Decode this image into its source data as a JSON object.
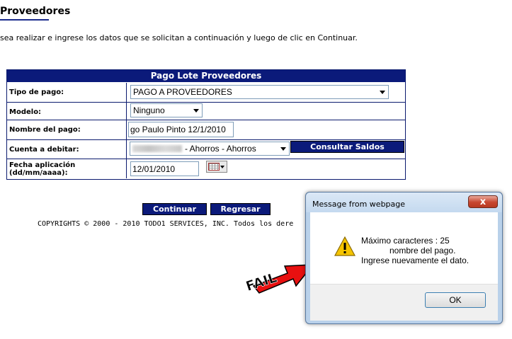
{
  "page": {
    "title": "Proveedores",
    "instructions": "sea realizar e ingrese los datos que se solicitan a continuación y luego de clic en Continuar."
  },
  "form": {
    "header": "Pago Lote Proveedores",
    "rows": [
      {
        "label": "Tipo de pago:",
        "value": "PAGO A PROVEEDORES"
      },
      {
        "label": "Modelo:",
        "value": "Ninguno"
      },
      {
        "label": "Nombre del pago:",
        "value": "go Paulo Pinto 12/1/2010"
      },
      {
        "label": "Cuenta a debitar:",
        "value": "- Ahorros - Ahorros"
      },
      {
        "label": "Fecha aplicación (dd/mm/aaaa):",
        "value": "12/01/2010"
      }
    ],
    "consultar_saldos": "Consultar Saldos"
  },
  "buttons": {
    "continuar": "Continuar",
    "regresar": "Regresar"
  },
  "footer": {
    "copyright": "COPYRIGHTS © 2000 - 2010 TODO1 SERVICES, INC. Todos los dere"
  },
  "dialog": {
    "title": "Message from webpage",
    "close": "x",
    "message_line1": "Máximo caracteres : 25",
    "message_line2": "            nombre del pago.",
    "message_line3": "Ingrese nuevamente el dato.",
    "ok": "OK"
  },
  "annotation": {
    "text": "FAIL",
    "color": "#e81010"
  },
  "colors": {
    "navy": "#0b1a7a",
    "dialog_frame": "#b9d1ea"
  },
  "icons": {
    "warning": "warning-icon",
    "calendar": "calendar-icon",
    "dropdown": "chevron-down-icon"
  }
}
